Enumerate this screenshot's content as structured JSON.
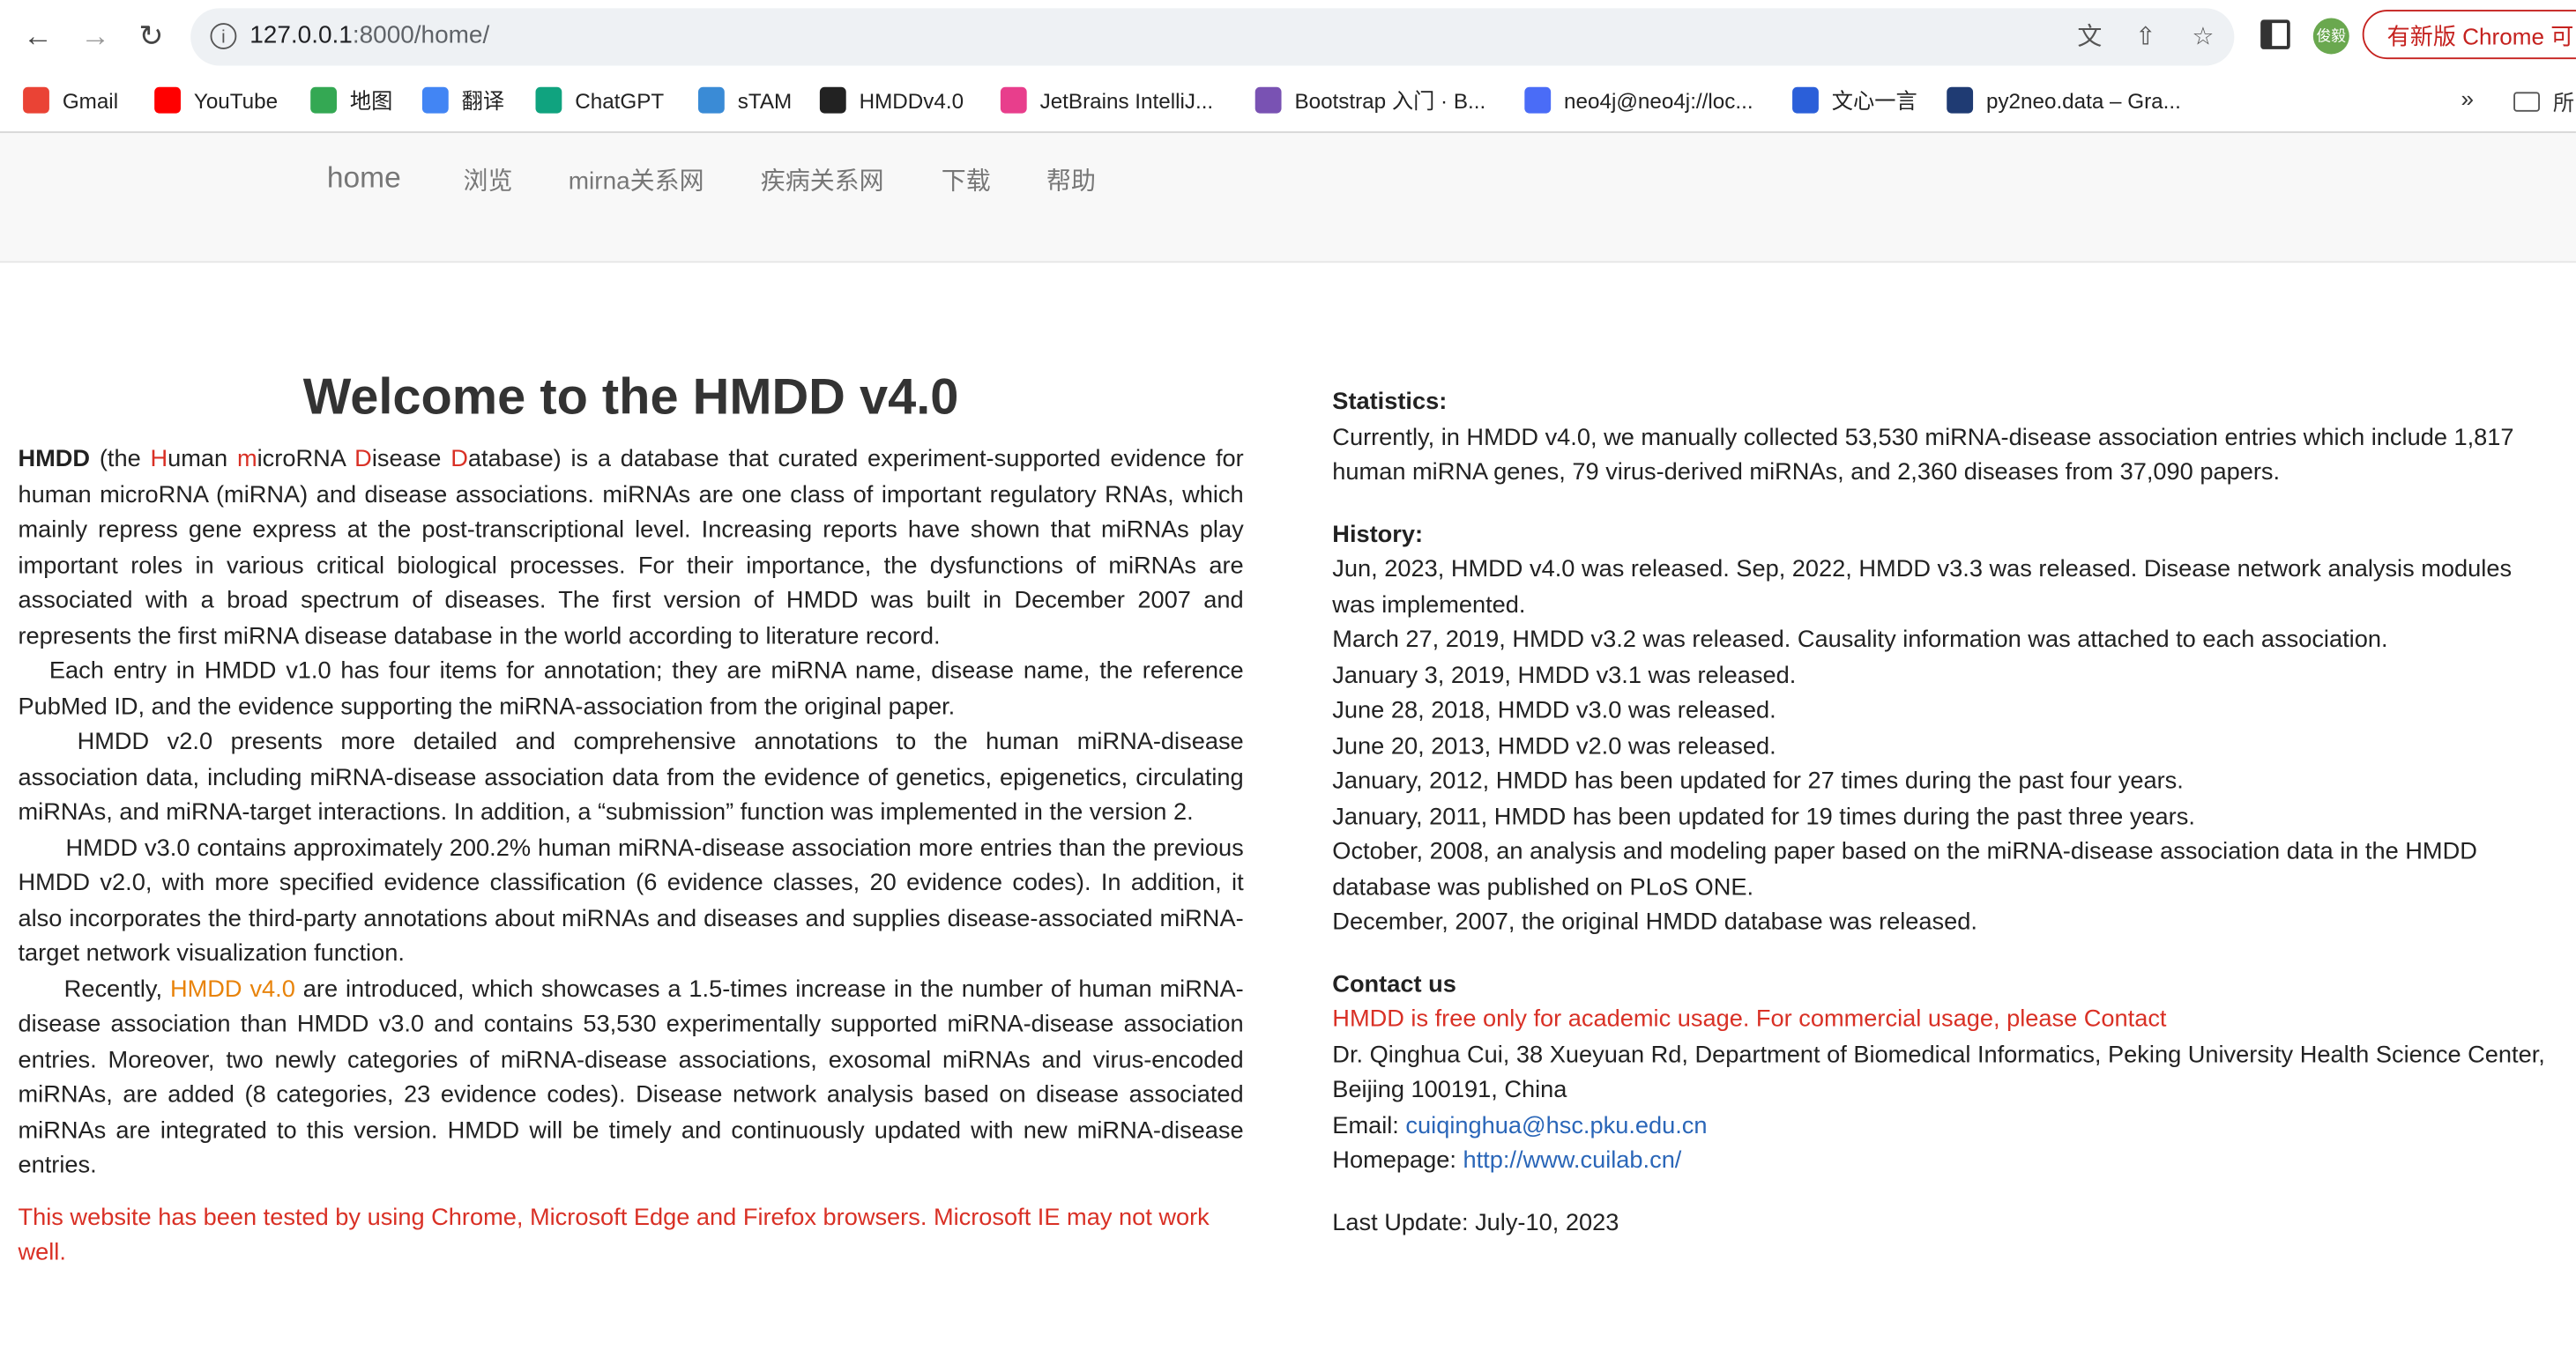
{
  "browser": {
    "url_host": "127.0.0.1",
    "url_rest": ":8000/home/",
    "profile_badge": "俊毅",
    "update_button": "有新版 Chrome 可",
    "bookmarks": [
      {
        "label": "Gmail",
        "icon": "gmail-icon",
        "color": "#ea4335"
      },
      {
        "label": "YouTube",
        "icon": "youtube-icon",
        "color": "#ff0000"
      },
      {
        "label": "地图",
        "icon": "maps-icon",
        "color": "#34a853"
      },
      {
        "label": "翻译",
        "icon": "translate-icon",
        "color": "#4285f4"
      },
      {
        "label": "ChatGPT",
        "icon": "chatgpt-icon",
        "color": "#10a37f"
      },
      {
        "label": "sTAM",
        "icon": "stam-icon",
        "color": "#3a8bd6"
      },
      {
        "label": "HMDDv4.0",
        "icon": "globe-icon",
        "color": "#222222"
      },
      {
        "label": "JetBrains IntelliJ...",
        "icon": "jetbrains-icon",
        "color": "#e83e8c"
      },
      {
        "label": "Bootstrap 入门 · B...",
        "icon": "bootstrap-icon",
        "color": "#7952b3"
      },
      {
        "label": "neo4j@neo4j://loc...",
        "icon": "neo4j-icon",
        "color": "#4a6cf7"
      },
      {
        "label": "文心一言",
        "icon": "wenxin-icon",
        "color": "#2b5fd9"
      },
      {
        "label": "py2neo.data – Gra...",
        "icon": "py2neo-icon",
        "color": "#1f3b73"
      }
    ],
    "bookmarks_folder": "所"
  },
  "nav": {
    "brand": "home",
    "items": [
      "浏览",
      "mirna关系网",
      "疾病关系网",
      "下载",
      "帮助"
    ]
  },
  "intro": {
    "title": "Welcome to the HMDD v4.0",
    "p1_lead": "HMDD",
    "p1_a": " (the ",
    "p1_H": "H",
    "p1_b": "uman ",
    "p1_m": "m",
    "p1_c": "icroRNA ",
    "p1_D": "D",
    "p1_d": "isease ",
    "p1_D2": "D",
    "p1_e": "atabase) is a database that curated experiment-supported evidence for human microRNA (miRNA) and disease associations. miRNAs are one class of important regulatory RNAs, which mainly repress gene express at the post-transcriptional level. Increasing reports have shown that miRNAs play important roles in various critical biological processes. For their importance, the dysfunctions of miRNAs are associated with a broad spectrum of diseases. The first version of HMDD was built in December 2007 and represents the first miRNA disease database in the world according to literature record.",
    "p2": "Each entry in HMDD v1.0 has four items for annotation; they are miRNA name, disease name, the reference PubMed ID, and the evidence supporting the miRNA-association from the original paper.",
    "p3": "HMDD v2.0 presents more detailed and comprehensive annotations to the human miRNA-disease association data, including miRNA-disease association data from the evidence of genetics, epigenetics, circulating miRNAs, and miRNA-target interactions. In addition, a “submission” function was implemented in the version 2.",
    "p4": "HMDD v3.0 contains approximately 200.2% human miRNA-disease association more entries than the previous HMDD v2.0, with more specified evidence classification (6 evidence classes, 20 evidence codes). In addition, it also incorporates the third-party annotations about miRNAs and diseases and supplies disease-associated miRNA-target network visualization function.",
    "p5_a": "Recently, ",
    "p5_link": "HMDD v4.0",
    "p5_b": " are introduced, which showcases a 1.5-times increase in the number of human miRNA-disease association than HMDD v3.0 and contains 53,530 experimentally supported miRNA-disease association entries. Moreover, two newly categories of miRNA-disease associations, exosomal miRNAs and virus-encoded miRNAs, are added (8 categories, 23 evidence codes). Disease network analysis based on disease associated miRNAs are integrated to this version. HMDD will be timely and continuously updated with new miRNA-disease entries.",
    "browser_note": "This website has been tested by using Chrome, Microsoft Edge and Firefox browsers. Microsoft IE may not work well."
  },
  "statistics": {
    "heading": "Statistics:",
    "text": "Currently, in HMDD v4.0, we manually collected 53,530 miRNA-disease association entries which include 1,817 human miRNA genes, 79 virus-derived miRNAs, and 2,360 diseases from 37,090 papers."
  },
  "history": {
    "heading": "History:",
    "items": [
      "Jun, 2023, HMDD v4.0 was released. Sep, 2022, HMDD v3.3 was released. Disease network analysis modules was implemented.",
      "March 27, 2019, HMDD v3.2 was released. Causality information was attached to each association.",
      "January 3, 2019, HMDD v3.1 was released.",
      "June 28, 2018, HMDD v3.0 was released.",
      "June 20, 2013, HMDD v2.0 was released.",
      "January, 2012, HMDD has been updated for 27 times during the past four years.",
      "January, 2011, HMDD has been updated for 19 times during the past three years.",
      "October, 2008, an analysis and modeling paper based on the miRNA-disease association data in the HMDD database was published on PLoS ONE.",
      "December, 2007, the original HMDD database was released."
    ]
  },
  "contact": {
    "heading": "Contact us",
    "notice": "HMDD is free only for academic usage. For commercial usage, please Contact",
    "address": "Dr. Qinghua Cui, 38 Xueyuan Rd, Department of Biomedical Informatics, Peking University Health Science Center, Beijing 100191, China",
    "email_label": "Email: ",
    "email": "cuiqinghua@hsc.pku.edu.cn",
    "homepage_label": "Homepage: ",
    "homepage": "http://www.cuilab.cn/"
  },
  "last_update": "Last Update: July-10, 2023"
}
